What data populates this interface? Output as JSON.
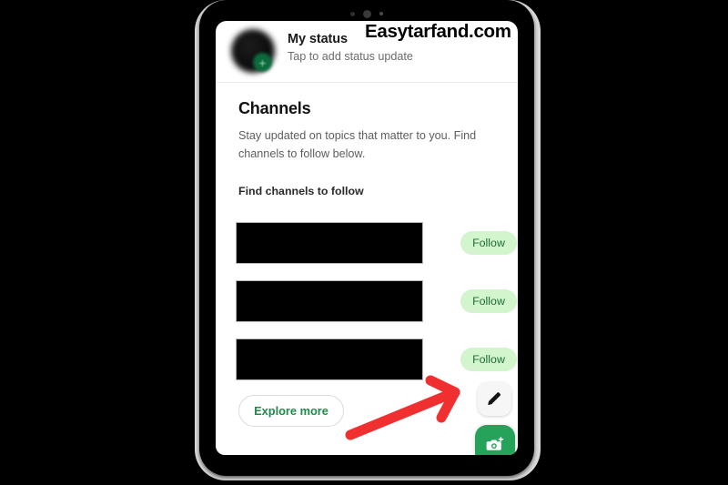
{
  "watermark": {
    "text": "Easytarfand.com"
  },
  "device": {
    "camera_dots": [
      "small",
      "big",
      "tiny"
    ]
  },
  "screen": {
    "status": {
      "title": "My status",
      "subtitle": "Tap to add status update",
      "avatar_badge_icon": "plus-icon"
    },
    "channels": {
      "title": "Channels",
      "description": "Stay updated on topics that matter to you. Find channels to follow below.",
      "find_label": "Find channels to follow",
      "rows": [
        {
          "name_redacted": true,
          "follow_label": "Follow"
        },
        {
          "name_redacted": true,
          "follow_label": "Follow"
        },
        {
          "name_redacted": true,
          "follow_label": "Follow"
        }
      ],
      "explore_label": "Explore more"
    },
    "fabs": {
      "pencil_icon": "pencil-icon",
      "camera_icon": "camera-plus-icon"
    }
  },
  "annotation": {
    "arrow_color": "#f03030",
    "points_to": "pencil-fab"
  },
  "colors": {
    "follow_pill_bg": "#d2f5cd",
    "follow_pill_text": "#1d6b36",
    "explore_text": "#1f8a4c",
    "camera_fab_bg": "#25a35a",
    "arrow_red": "#f03030",
    "page_background": "#000000",
    "backdrop": "#d9d9d9"
  }
}
